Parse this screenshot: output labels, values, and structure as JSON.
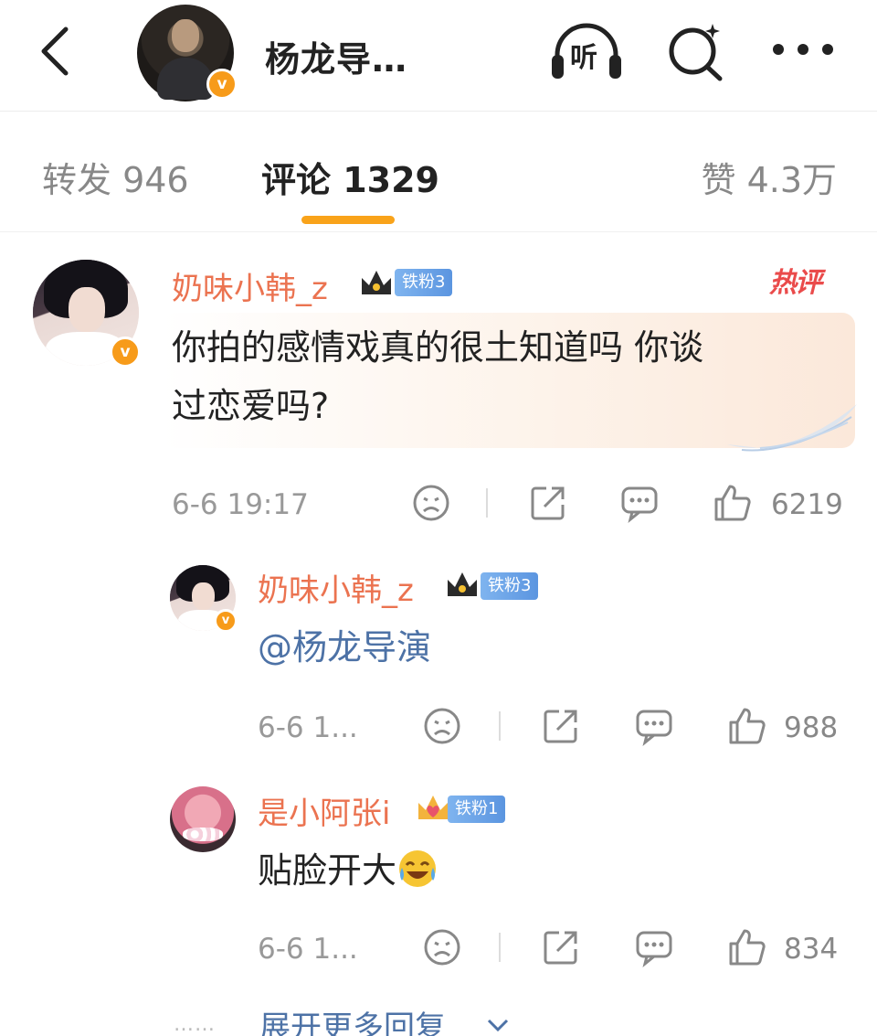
{
  "header": {
    "title": "杨龙导…",
    "listen_label": "听",
    "back_icon": "chevron-left-icon",
    "search_icon": "search-sparkle-icon",
    "more_icon": "more-dots-icon"
  },
  "tabs": {
    "repost": "转发 946",
    "comments": "评论 1329",
    "likes": "赞 4.3万",
    "active": "comments",
    "accent_color": "#f9a31a"
  },
  "comments": [
    {
      "username": "奶味小韩_z",
      "fan_badge": "铁粉3",
      "hot_tag": "热评",
      "text": "你拍的感情戏真的很土知道吗 你谈过恋爱吗?",
      "text_line1": "你拍的感情戏真的很土知道吗 你谈",
      "text_line2": "过恋爱吗?",
      "time": "6-6 19:17",
      "likes": "6219"
    },
    {
      "username": "奶味小韩_z",
      "fan_badge": "铁粉3",
      "text": "@杨龙导演",
      "time": "6-6 1...",
      "likes": "988"
    },
    {
      "username": "是小阿张i",
      "fan_badge": "铁粉1",
      "text": "贴脸开大",
      "emoji": "laugh-cry-emoji",
      "time": "6-6 1...",
      "likes": "834"
    }
  ],
  "expand_replies": {
    "dots": "……",
    "label": "展开更多回复"
  },
  "colors": {
    "username": "#eb7350",
    "link": "#4d72a6",
    "verified": "#f79b1a",
    "hot": "#ea4b4b"
  }
}
